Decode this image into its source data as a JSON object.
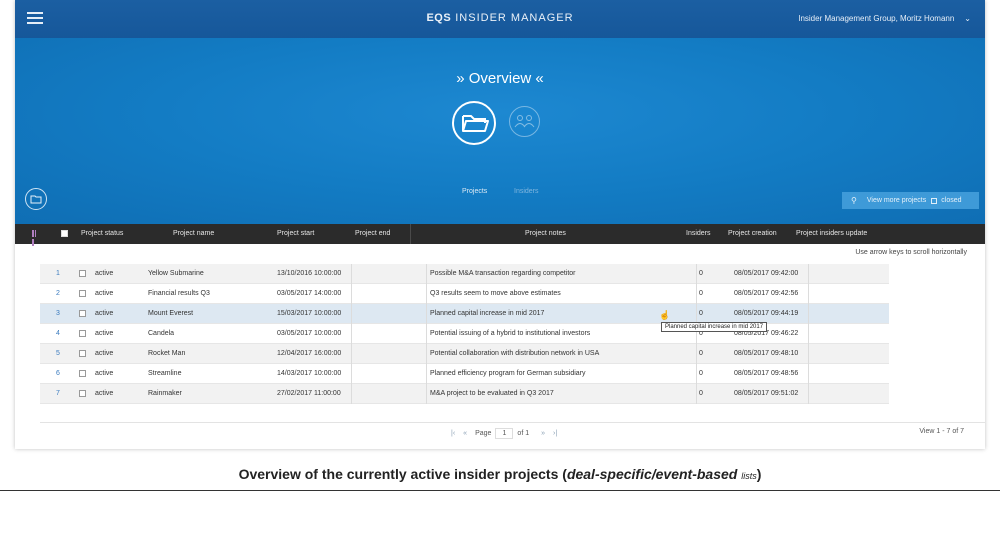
{
  "app": {
    "brand_bold": "EQS",
    "brand_rest": "INSIDER MANAGER",
    "user": "Insider Management Group, Moritz Homann"
  },
  "hero": {
    "title": "» Overview «",
    "nav": [
      {
        "label": "Projects"
      },
      {
        "label": "Insiders"
      }
    ]
  },
  "toolbar": {
    "view_more": "View more projects",
    "closed_label": "closed"
  },
  "table": {
    "columns": [
      "Project status",
      "Project name",
      "Project start",
      "Project end",
      "Project notes",
      "Insiders",
      "Project creation",
      "Project insiders update"
    ],
    "hint": "Use arrow keys to scroll horizontally",
    "rows": [
      {
        "n": "1",
        "status": "active",
        "name": "Yellow Submarine",
        "start": "13/10/2016 10:00:00",
        "end": "",
        "notes": "Possible M&A transaction regarding competitor",
        "insiders": "0",
        "creation": "08/05/2017 09:42:00"
      },
      {
        "n": "2",
        "status": "active",
        "name": "Financial results Q3",
        "start": "03/05/2017 14:00:00",
        "end": "",
        "notes": "Q3 results seem to move above estimates",
        "insiders": "0",
        "creation": "08/05/2017 09:42:56"
      },
      {
        "n": "3",
        "status": "active",
        "name": "Mount Everest",
        "start": "15/03/2017 10:00:00",
        "end": "",
        "notes": "Planned capital increase in mid 2017",
        "insiders": "0",
        "creation": "08/05/2017 09:44:19"
      },
      {
        "n": "4",
        "status": "active",
        "name": "Candela",
        "start": "03/05/2017 10:00:00",
        "end": "",
        "notes": "Potential issuing of a hybrid to institutional investors",
        "insiders": "0",
        "creation": "08/05/2017 09:46:22"
      },
      {
        "n": "5",
        "status": "active",
        "name": "Rocket Man",
        "start": "12/04/2017 16:00:00",
        "end": "",
        "notes": "Potential collaboration with distribution network in USA",
        "insiders": "0",
        "creation": "08/05/2017 09:48:10"
      },
      {
        "n": "6",
        "status": "active",
        "name": "Streamline",
        "start": "14/03/2017 10:00:00",
        "end": "",
        "notes": "Planned efficiency program for German subsidiary",
        "insiders": "0",
        "creation": "08/05/2017 09:48:56"
      },
      {
        "n": "7",
        "status": "active",
        "name": "Rainmaker",
        "start": "27/02/2017 11:00:00",
        "end": "",
        "notes": "M&A project to be evaluated in Q3 2017",
        "insiders": "0",
        "creation": "08/05/2017 09:51:02"
      }
    ],
    "tooltip": "Planned capital increase in mid 2017"
  },
  "pager": {
    "page_label": "Page",
    "page_value": "1",
    "of_label": "of 1",
    "view_count": "View 1 - 7 of 7"
  },
  "caption": {
    "main": "Overview of the currently active insider projects (",
    "italic": "deal-specific/event-based",
    "small": "lists",
    "close": ")"
  }
}
